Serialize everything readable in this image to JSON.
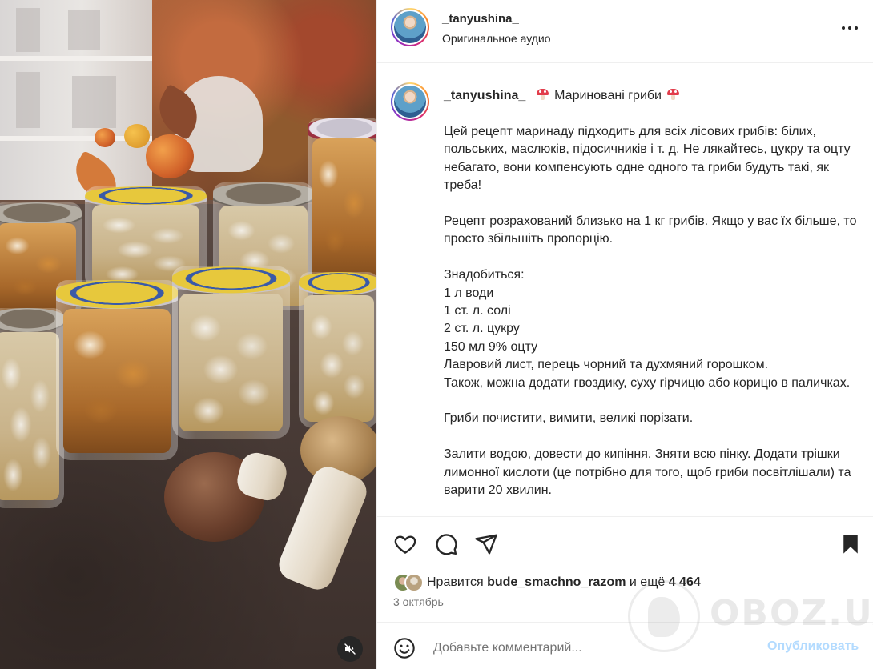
{
  "post": {
    "username": "_tanyushina_",
    "audio_label": "Оригинальное аудио",
    "more_icon": "more-horizontal-icon"
  },
  "caption": {
    "username": "_tanyushina_",
    "title": "Мариновані гриби",
    "title_icon": "mushroom-emoji",
    "lines": [
      "Цей рецепт маринаду підходить для всіх лісових грибів: білих, польських, маслюків, підосичників і т. д. Не лякайтесь, цукру та оцту небагато, вони компенсують одне одного та гриби будуть такі, як треба!",
      "",
      "Рецепт розрахований близько на 1 кг грибів. Якщо у вас їх більше, то просто збільшіть пропорцію.",
      "",
      "Знадобиться:",
      "1 л води",
      "1 ст. л. солі",
      "2 ст. л. цукру",
      "150 мл 9% оцту",
      "Лавровий лист, перець чорний та духмяний горошком.",
      "Також, можна додати гвоздику, суху гірчицю або корицю в паличках.",
      "",
      "Гриби почистити, вимити, великі порізати.",
      "",
      "Залити водою, довести до кипіння. Зняти всю пінку. Додати трішки лимонної кислоти (це потрібно для того, щоб гриби посвітлішали) та варити 20 хвилин."
    ]
  },
  "actions": {
    "like_icon": "heart-icon",
    "comment_icon": "comment-icon",
    "share_icon": "send-icon",
    "save_icon": "bookmark-icon",
    "saved": true
  },
  "likes": {
    "prefix": "Нравится",
    "user": "bude_smachno_razom",
    "middle": "и ещё",
    "count": "4 464"
  },
  "date": "3 октябрь",
  "comment": {
    "placeholder": "Добавьте комментарий...",
    "publish_label": "Опубликовать",
    "emoji_icon": "smiley-icon"
  },
  "media": {
    "mute_icon": "speaker-muted-icon"
  },
  "watermark": {
    "text": "OBOZ.UA"
  },
  "colors": {
    "text": "#262626",
    "secondary": "#737373",
    "publish_disabled": "#b3dbff",
    "divider": "#efefef"
  }
}
